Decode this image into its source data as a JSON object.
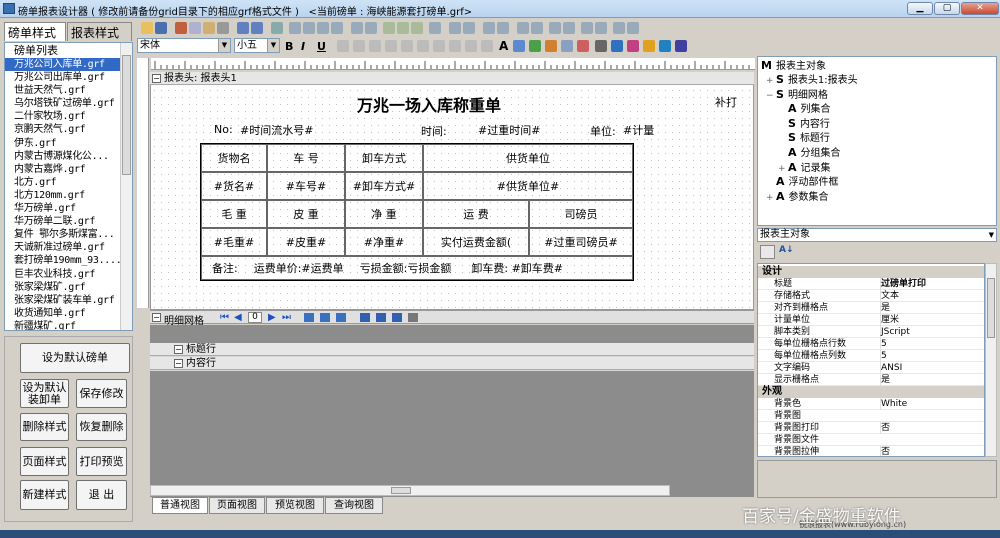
{
  "window": {
    "title": "磅单报表设计器 ( 修改前请备份grid目录下的相应grf格式文件 )",
    "current_file": "<当前磅单 : 海峡能源套打磅单.grf>",
    "min_glyph": "▁",
    "max_glyph": "▢",
    "close_glyph": "✕"
  },
  "left_tabs": [
    "磅单样式",
    "报表样式"
  ],
  "template_list": {
    "header": "磅单列表",
    "items": [
      "万兆公司入库单.grf",
      "万兆公司出库单.grf",
      "世益天然气.grf",
      "乌尔塔铁矿过磅单.grf",
      "二什家牧场.grf",
      "京鹏天然气.grf",
      "伊东.grf",
      "内蒙古博源煤化公...",
      "内蒙古嘉烨.grf",
      "北方.grf",
      "北方120mm.grf",
      "华万磅单.grf",
      "华万磅单二联.grf",
      "复件 鄂尔多斯煤富...",
      "天诚新准过磅单.grf",
      "套打磅单190mm_93....",
      "巨丰农业科技.grf",
      "张家梁煤矿.grf",
      "张家梁煤矿装车单.grf",
      "收货通知单.grf",
      "新疆煤矿.grf"
    ],
    "selected_index": 0
  },
  "left_buttons": {
    "set_default": "设为默认磅单",
    "set_default_load": "设为默认\n装卸单",
    "save": "保存修改",
    "delete_style": "删除样式",
    "restore_delete": "恢复删除",
    "page_style": "页面样式",
    "print_preview": "打印预览",
    "new_style": "新建样式",
    "exit": "退 出"
  },
  "font_bar": {
    "font_name": "宋体",
    "font_size": "小五",
    "bold": "B",
    "italic": "I",
    "underline": "U"
  },
  "report": {
    "band_header": "报表头: 报表头1",
    "title": "万兆一场入库称重单",
    "reprint": "补打",
    "no_label": "No:",
    "serial_field": "#时间流水号#",
    "time_label": "时间:",
    "time_field": "#过重时间#",
    "unit_label": "单位:",
    "unit_field": "#计量",
    "row1": [
      "货物名",
      "车 号",
      "卸车方式",
      "供货单位"
    ],
    "row2": [
      "#货名#",
      "#车号#",
      "#卸车方式#",
      "#供货单位#"
    ],
    "row3": [
      "毛 重",
      "皮 重",
      "净 重",
      "运 费",
      "司磅员"
    ],
    "row4": [
      "#毛重#",
      "#皮重#",
      "#净重#",
      "实付运费金额(",
      "#过重司磅员#"
    ],
    "remark": "备注:",
    "unit_price": "运费单价:#运费单",
    "loss_amount": "亏损金额:亏损金额",
    "unload_fee": "卸车费: #卸车费#"
  },
  "detail_bar": {
    "label": "明细网格",
    "page_value": "0"
  },
  "grid_rows": [
    "标题行",
    "内容行"
  ],
  "bottom_tabs": [
    "普通视图",
    "页面视图",
    "预览视图",
    "查询视图"
  ],
  "tree": {
    "root": "报表主对象",
    "nodes": [
      {
        "icon": "S",
        "label": "报表头1:报表头",
        "level": 1,
        "expand": "+"
      },
      {
        "icon": "S",
        "label": "明细网格",
        "level": 1,
        "expand": "−"
      },
      {
        "icon": "A",
        "label": "列集合",
        "level": 2,
        "expand": ""
      },
      {
        "icon": "S",
        "label": "内容行",
        "level": 2,
        "expand": ""
      },
      {
        "icon": "S",
        "label": "标题行",
        "level": 2,
        "expand": ""
      },
      {
        "icon": "A",
        "label": "分组集合",
        "level": 2,
        "expand": ""
      },
      {
        "icon": "A",
        "label": "记录集",
        "level": 2,
        "expand": "+"
      },
      {
        "icon": "A",
        "label": "浮动部件框",
        "level": 1,
        "expand": ""
      },
      {
        "icon": "A",
        "label": "参数集合",
        "level": 1,
        "expand": "+"
      }
    ]
  },
  "property_combo": "报表主对象",
  "properties": {
    "cat_design": "设计",
    "design": [
      [
        "标题",
        "过磅单打印"
      ],
      [
        "存储格式",
        "文本"
      ],
      [
        "对齐到栅格点",
        "是"
      ],
      [
        "计量单位",
        "厘米"
      ],
      [
        "脚本类别",
        "JScript"
      ],
      [
        "每单位栅格点行数",
        "5"
      ],
      [
        "每单位栅格点列数",
        "5"
      ],
      [
        "文字编码",
        "ANSI"
      ],
      [
        "显示栅格点",
        "是"
      ]
    ],
    "cat_appearance": "外观",
    "appearance": [
      [
        "背景色",
        "White"
      ],
      [
        "背景图",
        ""
      ],
      [
        "背景图打印",
        "否"
      ],
      [
        "背景图文件",
        ""
      ],
      [
        "背景图拉伸",
        "否"
      ]
    ]
  },
  "status_text": "锐浪报表(www.rubylong.cn)",
  "watermark": "百家号/金盛物重软件",
  "colors": {
    "selection": "#3169c6",
    "panel": "#d4d0c8"
  }
}
